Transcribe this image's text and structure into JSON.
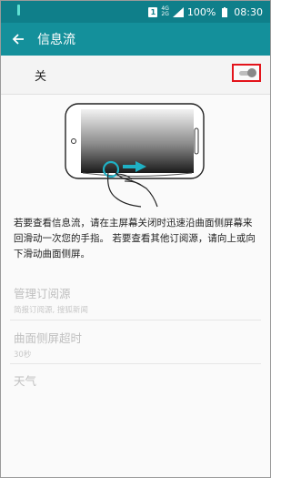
{
  "status_bar": {
    "sim_badge": "1",
    "network_top": "4G",
    "network_bottom": "2G",
    "battery": "100%",
    "time": "08:30"
  },
  "app_bar": {
    "title": "信息流",
    "back_icon": "arrow-left-icon"
  },
  "toggle": {
    "label": "关",
    "state": "off"
  },
  "description": "若要查看信息流，请在主屏幕关闭时迅速沿曲面侧屏幕来回滑动一次您的手指。 若要查看其他订阅源，请向上或向下滑动曲面侧屏。",
  "settings": [
    {
      "title": "管理订阅源",
      "subtitle": "简报订阅源, 搜狐新闻"
    },
    {
      "title": "曲面侧屏超时",
      "subtitle": "30秒"
    },
    {
      "title": "天气",
      "subtitle": ""
    }
  ],
  "colors": {
    "status_bar": "#0f7f8a",
    "app_bar": "#14909b",
    "highlight_box": "#e3141b",
    "disabled_text": "#bfbfbf"
  }
}
